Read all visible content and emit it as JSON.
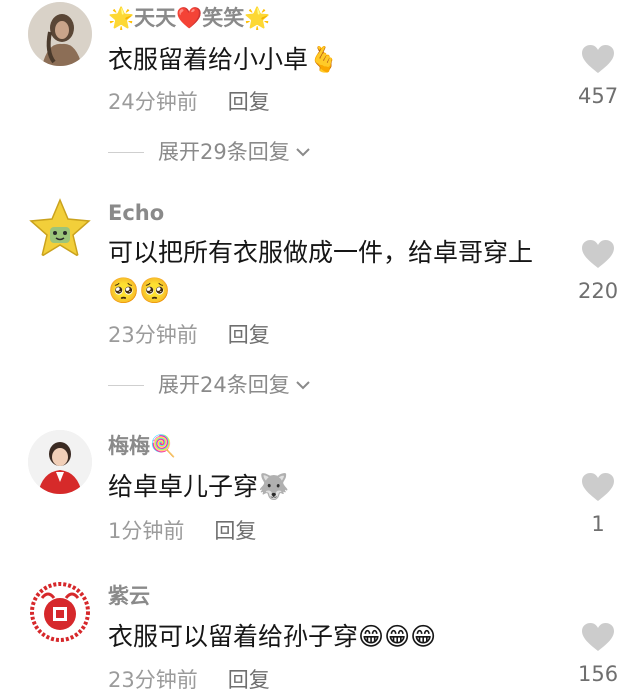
{
  "comments": [
    {
      "username": "🌟天天❤️笑笑🌟",
      "text": "衣服留着给小小卓🫰",
      "time": "24分钟前",
      "reply": "回复",
      "likes": "457",
      "expand": "展开29条回复",
      "avatar": "woman-portrait-avatar"
    },
    {
      "username": "Echo",
      "text": "可以把所有衣服做成一件，给卓哥穿上🥺🥺",
      "time": "23分钟前",
      "reply": "回复",
      "likes": "220",
      "expand": "展开24条回复",
      "avatar": "star-character-avatar"
    },
    {
      "username": "梅梅🍭",
      "text": "给卓卓儿子穿🐺",
      "time": "1分钟前",
      "reply": "回复",
      "likes": "1",
      "avatar": "woman-red-jacket-avatar"
    },
    {
      "username": "紫云",
      "text": "衣服可以留着给孙子穿😁😁😁",
      "time": "23分钟前",
      "reply": "回复",
      "likes": "156",
      "avatar": "red-papercut-avatar"
    }
  ],
  "colors": {
    "text": "#161616",
    "meta": "#9b9b9b",
    "heart": "#cccccc"
  }
}
